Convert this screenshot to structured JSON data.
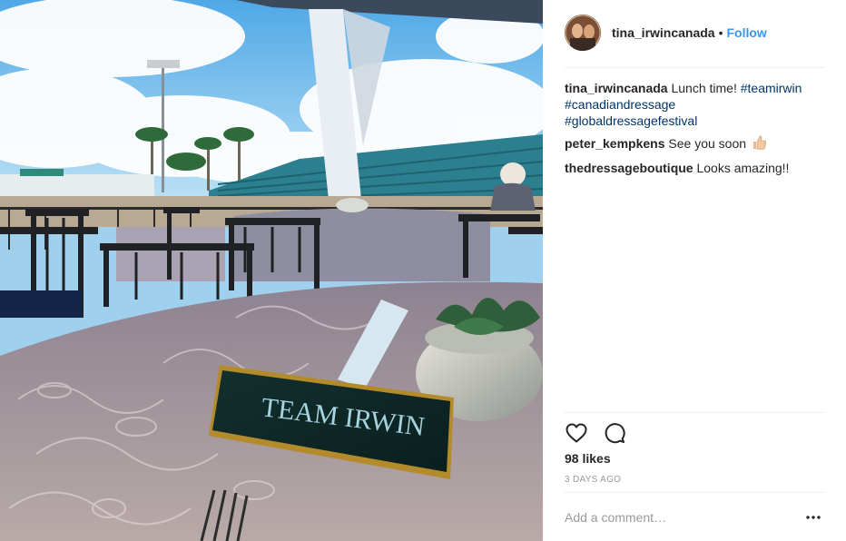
{
  "post": {
    "image": {
      "place_card_text": "TEAM IRWIN"
    },
    "header": {
      "username": "tina_irwincanada",
      "separator": "•",
      "follow_label": "Follow"
    },
    "caption": {
      "username": "tina_irwincanada",
      "text": "Lunch time!",
      "hashtags": [
        "#teamirwin",
        "#canadiandressage",
        "#globaldressagefestival"
      ]
    },
    "comments": [
      {
        "username": "peter_kempkens",
        "text": "See you soon",
        "emoji": "thumbs-up-icon"
      },
      {
        "username": "thedressageboutique",
        "text": "Looks amazing!!"
      }
    ],
    "likes": "98 likes",
    "time_ago": "3 DAYS AGO",
    "add_comment_placeholder": "Add a comment…"
  },
  "colors": {
    "link_blue": "#3897f0",
    "hashtag": "#003569",
    "muted": "#999999",
    "text": "#262626",
    "divider": "#efefef"
  },
  "icons": {
    "like": "heart-icon",
    "comment": "comment-bubble-icon",
    "more": "more-options-icon"
  }
}
